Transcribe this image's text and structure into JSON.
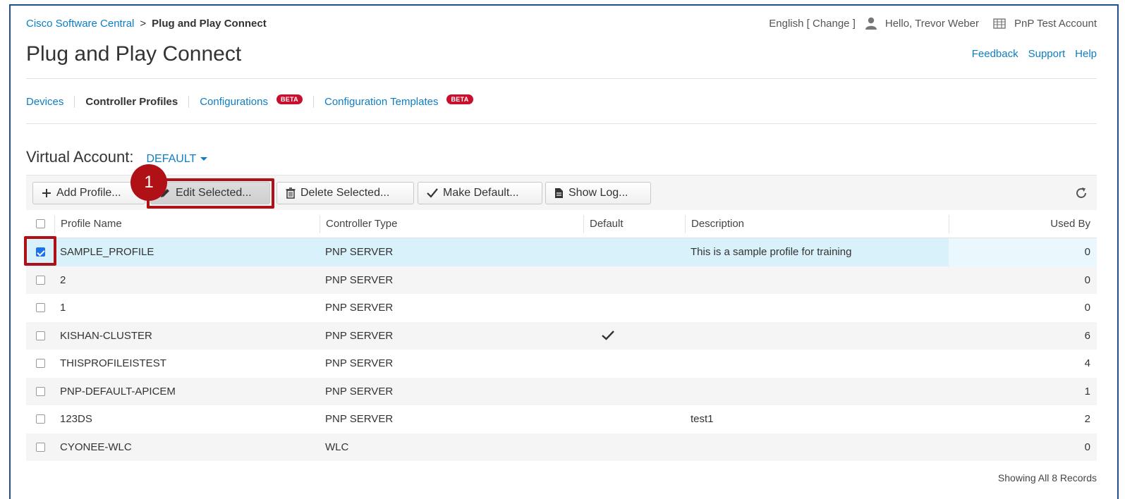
{
  "breadcrumb": {
    "root": "Cisco Software Central",
    "separator": ">",
    "current": "Plug and Play Connect"
  },
  "page_title": "Plug and Play Connect",
  "topbar": {
    "language": "English [ Change ]",
    "greeting": "Hello, Trevor Weber",
    "account": "PnP Test Account",
    "links": [
      "Feedback",
      "Support",
      "Help"
    ]
  },
  "tabs": [
    {
      "label": "Devices",
      "active": false,
      "beta": false
    },
    {
      "label": "Controller Profiles",
      "active": true,
      "beta": false
    },
    {
      "label": "Configurations",
      "active": false,
      "beta": true
    },
    {
      "label": "Configuration Templates",
      "active": false,
      "beta": true
    }
  ],
  "beta_label": "BETA",
  "virtual_account": {
    "label": "Virtual Account:",
    "value": "DEFAULT"
  },
  "toolbar": {
    "add": "Add Profile...",
    "edit": "Edit Selected...",
    "delete": "Delete Selected...",
    "make_default": "Make Default...",
    "show_log": "Show Log..."
  },
  "callout_number": "1",
  "table": {
    "columns": [
      "Profile Name",
      "Controller Type",
      "Default",
      "Description",
      "Used By"
    ],
    "rows": [
      {
        "name": "SAMPLE_PROFILE",
        "type": "PNP SERVER",
        "default": false,
        "description": "This is a sample profile for training",
        "used_by": "0",
        "checked": true
      },
      {
        "name": "2",
        "type": "PNP SERVER",
        "default": false,
        "description": "",
        "used_by": "0",
        "checked": false
      },
      {
        "name": "1",
        "type": "PNP SERVER",
        "default": false,
        "description": "",
        "used_by": "0",
        "checked": false
      },
      {
        "name": "KISHAN-CLUSTER",
        "type": "PNP SERVER",
        "default": true,
        "description": "",
        "used_by": "6",
        "checked": false
      },
      {
        "name": "THISPROFILEISTEST",
        "type": "PNP SERVER",
        "default": false,
        "description": "",
        "used_by": "4",
        "checked": false
      },
      {
        "name": "PNP-DEFAULT-APICEM",
        "type": "PNP SERVER",
        "default": false,
        "description": "",
        "used_by": "1",
        "checked": false
      },
      {
        "name": "123DS",
        "type": "PNP SERVER",
        "default": false,
        "description": "test1",
        "used_by": "2",
        "checked": false
      },
      {
        "name": "CYONEE-WLC",
        "type": "WLC",
        "default": false,
        "description": "",
        "used_by": "0",
        "checked": false
      }
    ]
  },
  "footer": "Showing All 8 Records",
  "colors": {
    "link": "#0d7ec4",
    "highlight": "#b01117",
    "beta": "#c8102e",
    "selected_row": "#d9f1fa"
  }
}
